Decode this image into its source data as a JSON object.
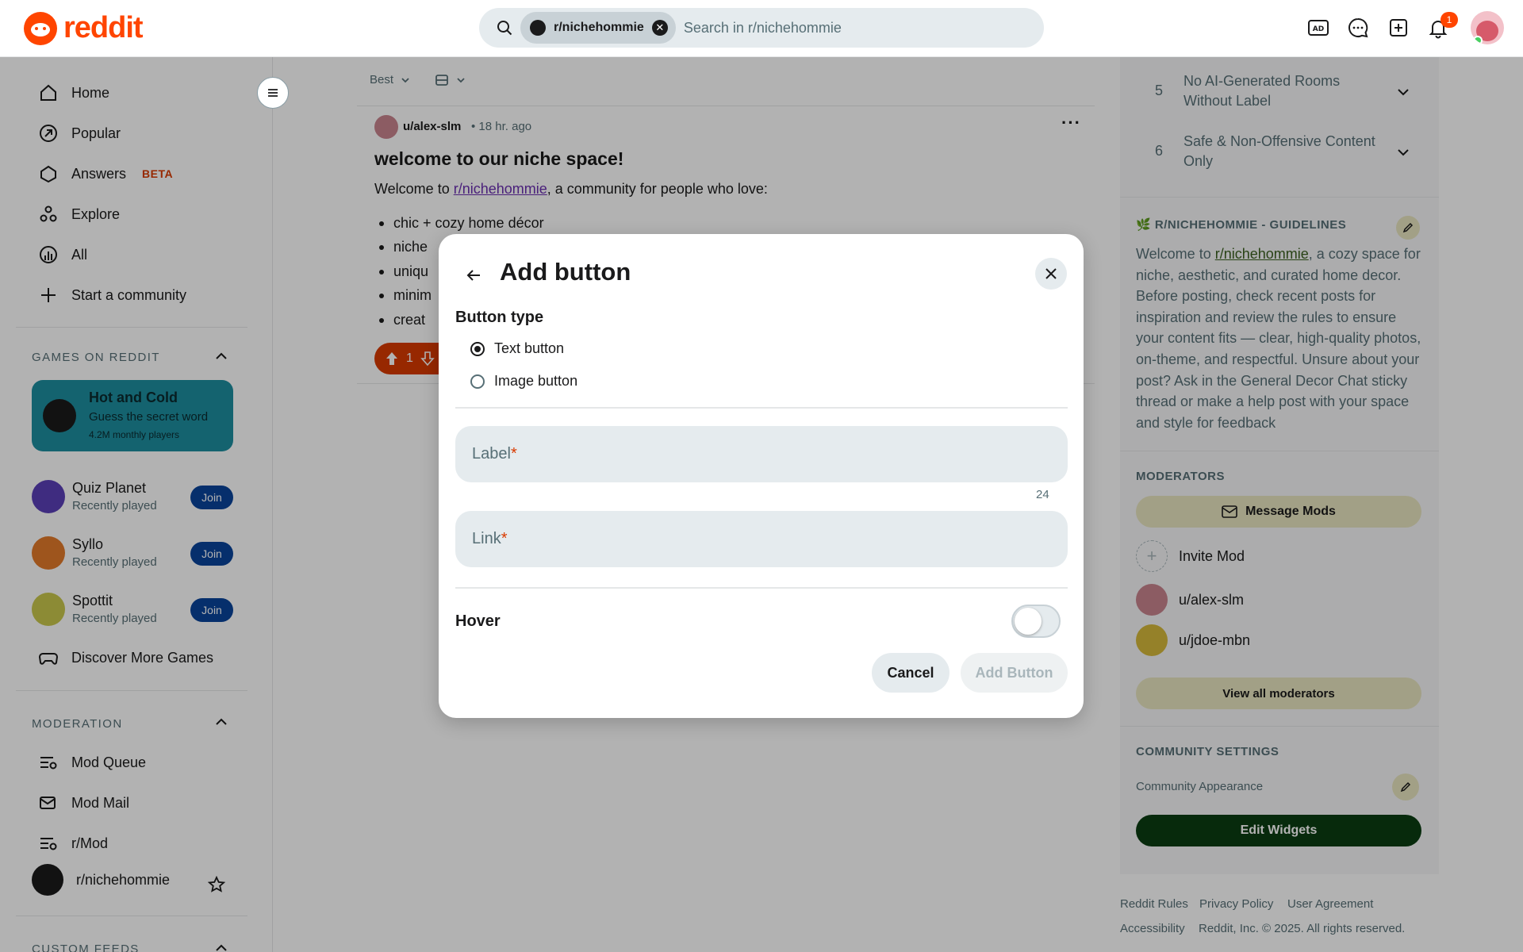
{
  "header": {
    "logo_text": "reddit",
    "search_chip": "r/nichehommie",
    "search_placeholder": "Search in r/nichehommie",
    "notification_count": "1",
    "icons": [
      "advertise-icon",
      "chat-icon",
      "create-post-icon",
      "notification-icon"
    ]
  },
  "sidebar": {
    "nav": [
      {
        "label": "Home",
        "icon": "home-icon"
      },
      {
        "label": "Popular",
        "icon": "popular-icon"
      },
      {
        "label": "Answers",
        "icon": "answers-icon",
        "badge": "BETA"
      },
      {
        "label": "Explore",
        "icon": "explore-icon"
      },
      {
        "label": "All",
        "icon": "all-icon"
      },
      {
        "label": "Start a community",
        "icon": "plus-icon"
      }
    ],
    "games_heading": "GAMES ON REDDIT",
    "featured_game": {
      "title": "Hot and Cold",
      "subtitle": "Guess the secret word",
      "players": "4.2M monthly players"
    },
    "games": [
      {
        "name": "Quiz Planet",
        "status": "Recently played",
        "button": "Join"
      },
      {
        "name": "Syllo",
        "status": "Recently played",
        "button": "Join"
      },
      {
        "name": "Spottit",
        "status": "Recently played",
        "button": "Join"
      }
    ],
    "discover_label": "Discover More Games",
    "moderation_heading": "MODERATION",
    "moderation": [
      {
        "label": "Mod Queue",
        "icon": "mod-queue-icon"
      },
      {
        "label": "Mod Mail",
        "icon": "mod-mail-icon"
      },
      {
        "label": "r/Mod",
        "icon": "r-mod-icon"
      },
      {
        "label": "r/nichehommie",
        "icon": "community-avatar"
      }
    ],
    "custom_feeds_heading": "CUSTOM FEEDS"
  },
  "feed": {
    "sort": "Best",
    "post": {
      "user": "u/alex-slm",
      "time": "18 hr. ago",
      "title": "welcome to our niche space!",
      "intro_before": "Welcome to ",
      "intro_link": "r/nichehommie",
      "intro_after": ", a community for people who love:",
      "bullets": [
        "chic + cozy home décor",
        "niche",
        "uniqu",
        "minim",
        "creat"
      ],
      "votes": "1"
    }
  },
  "rightbar": {
    "rules": [
      {
        "num": "5",
        "text": "No AI-Generated Rooms Without Label"
      },
      {
        "num": "6",
        "text": "Safe & Non-Offensive Content Only"
      }
    ],
    "guidelines_heading": "R/NICHEHOMMIE - GUIDELINES",
    "guidelines_before": "Welcome to ",
    "guidelines_link": "r/nichehommie",
    "guidelines_after": ", a cozy space for niche, aesthetic, and curated home decor. Before posting, check recent posts for inspiration and review the rules to ensure your content fits — clear, high-quality photos, on-theme, and respectful. Unsure about your post? Ask in the General Decor Chat sticky thread or make a help post with your space and style for feedback",
    "moderators_heading": "MODERATORS",
    "message_mods": "Message Mods",
    "invite_mod": "Invite Mod",
    "mods": [
      "u/alex-slm",
      "u/jdoe-mbn"
    ],
    "view_all_mods": "View all moderators",
    "settings_heading": "COMMUNITY SETTINGS",
    "community_appearance": "Community Appearance",
    "edit_widgets": "Edit Widgets",
    "footer_links": [
      "Reddit Rules",
      "Privacy Policy",
      "User Agreement"
    ],
    "footer_line2": [
      "Accessibility",
      "Reddit, Inc. © 2025. All rights reserved."
    ]
  },
  "modal": {
    "title": "Add button",
    "section": "Button type",
    "options": [
      {
        "label": "Text button",
        "selected": true
      },
      {
        "label": "Image button",
        "selected": false
      }
    ],
    "label_field": {
      "placeholder": "Label",
      "required_mark": "*",
      "counter": "24",
      "value": ""
    },
    "link_field": {
      "placeholder": "Link",
      "required_mark": "*",
      "value": ""
    },
    "hover_label": "Hover",
    "hover_on": false,
    "cancel": "Cancel",
    "submit": "Add Button"
  }
}
